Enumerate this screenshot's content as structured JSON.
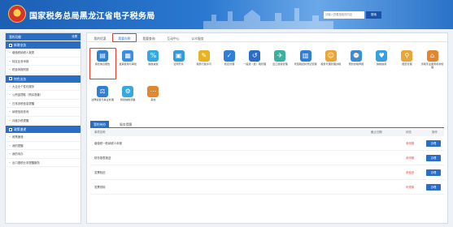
{
  "header": {
    "title": "国家税务总局黑龙江省电子税务局",
    "search_placeholder": "请输入您要搜索的内容",
    "search_button": "搜索"
  },
  "sidebar": {
    "top_label": "我的功能",
    "top_more": "设置",
    "sections": [
      {
        "title": "新增业务",
        "items": [
          "增值税纳税人报表",
          "特定业务申报",
          "税费申报附报"
        ]
      },
      {
        "title": "特色业务",
        "items": [
          "大企业个性化服务",
          "公积金提取（购买首套）",
          "日常涉税信息提醒",
          "纳税信用查询",
          "月度办税提醒"
        ]
      },
      {
        "title": "政策速递",
        "items": [
          "政策速递",
          "我的提醒",
          "我的待办",
          "出口退税业务提醒服务"
        ]
      }
    ]
  },
  "main": {
    "tabs": [
      "我的优惠",
      "我要办税",
      "我要查询",
      "互动中心",
      "公众服务"
    ],
    "active_tab": 1,
    "apps_row1": [
      {
        "label": "综合信息报告",
        "icon": "document-report-icon",
        "color": "#2f7fd6"
      },
      {
        "label": "发票使用与审批",
        "icon": "invoice-icon",
        "color": "#3a8ee6"
      },
      {
        "label": "税收减免",
        "icon": "tax-reduction-icon",
        "color": "#36a8e0"
      },
      {
        "label": "证明开具",
        "icon": "certificate-icon",
        "color": "#2f9be0"
      },
      {
        "label": "税务行政许可",
        "icon": "permit-icon",
        "color": "#e8b223"
      },
      {
        "label": "核定管理",
        "icon": "approval-icon",
        "color": "#2f7fd6"
      },
      {
        "label": "一般退（抵）税管理",
        "icon": "refund-icon",
        "color": "#2a6dc5"
      },
      {
        "label": "出口退税管理",
        "icon": "export-refund-icon",
        "color": "#3ab0a0"
      },
      {
        "label": "增值税抵扣凭证管理",
        "icon": "vat-voucher-icon",
        "color": "#2f7fd6"
      },
      {
        "label": "税务代理管理办税",
        "icon": "agent-icon",
        "color": "#e8a53a"
      },
      {
        "label": "预约办税申报",
        "icon": "appointment-icon",
        "color": "#2f8fe0"
      },
      {
        "label": "纳税信用",
        "icon": "credit-icon",
        "color": "#3a9fe0"
      },
      {
        "label": "稽查管理",
        "icon": "inspection-icon",
        "color": "#e8a53a"
      },
      {
        "label": "涉税专业服务机构管理",
        "icon": "service-agency-icon",
        "color": "#e0872f"
      }
    ],
    "apps_row2": [
      {
        "label": "法律追责与争议处理",
        "icon": "legal-icon",
        "color": "#2f7fd6"
      },
      {
        "label": "特别纳税调整",
        "icon": "special-adjust-icon",
        "color": "#36a8e0"
      },
      {
        "label": "其他",
        "icon": "other-icon",
        "color": "#e0872f"
      }
    ],
    "subtabs": [
      "我的待办",
      "服务提醒"
    ],
    "table": {
      "headers": [
        "事项名称",
        "截止日期",
        "状态",
        "操作"
      ],
      "rows": [
        {
          "name": "增值税一般纳税人申报",
          "date": "",
          "status": "未申报",
          "op": "办理"
        },
        {
          "name": "财务报表报送",
          "date": "",
          "status": "未申报",
          "op": "办理"
        },
        {
          "name": "发票验旧",
          "date": "",
          "status": "未验旧",
          "op": "办理"
        },
        {
          "name": "发票领用",
          "date": "",
          "status": "可领用",
          "op": "办理"
        }
      ]
    }
  }
}
